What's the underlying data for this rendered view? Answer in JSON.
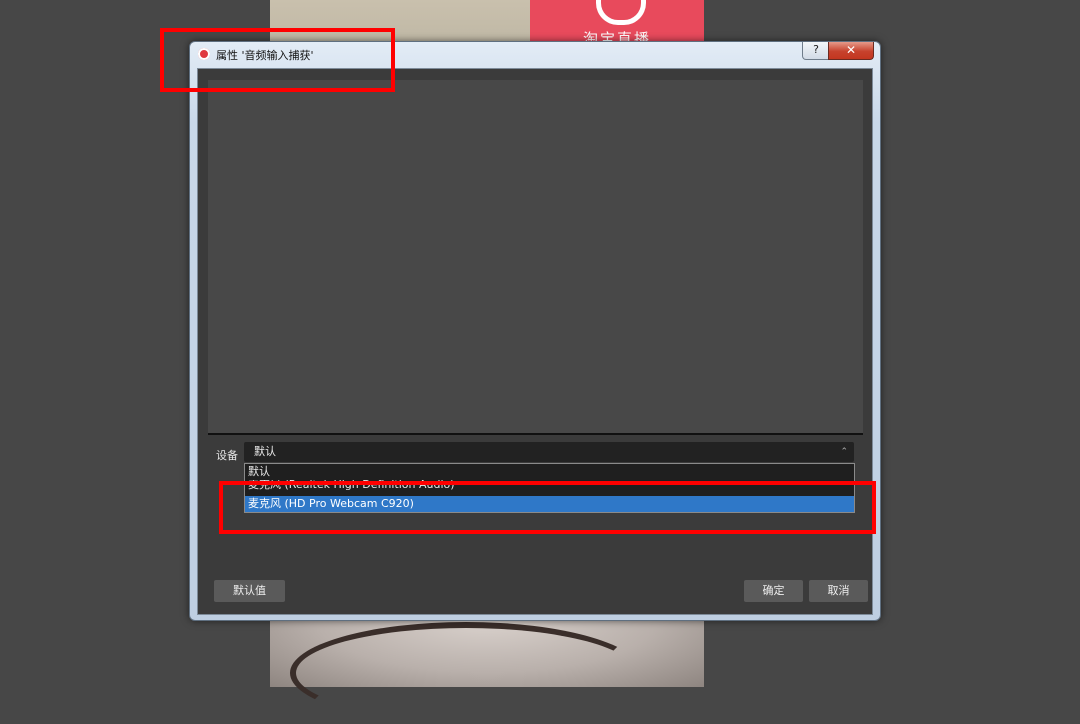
{
  "background": {
    "logo_text": "淘宝直播"
  },
  "window": {
    "title": "属性 '音频输入捕获'",
    "help_label": "?",
    "close_label": "✕"
  },
  "device": {
    "label": "设备",
    "selected": "默认",
    "options": [
      "默认",
      "麦克风 (Realtek High Definition Audio)",
      "麦克风 (HD Pro Webcam C920)"
    ],
    "highlighted_index": 2
  },
  "buttons": {
    "defaults": "默认值",
    "ok": "确定",
    "cancel": "取消"
  },
  "colors": {
    "highlight_annotation": "#ff0000",
    "selection": "#2f78c8"
  }
}
